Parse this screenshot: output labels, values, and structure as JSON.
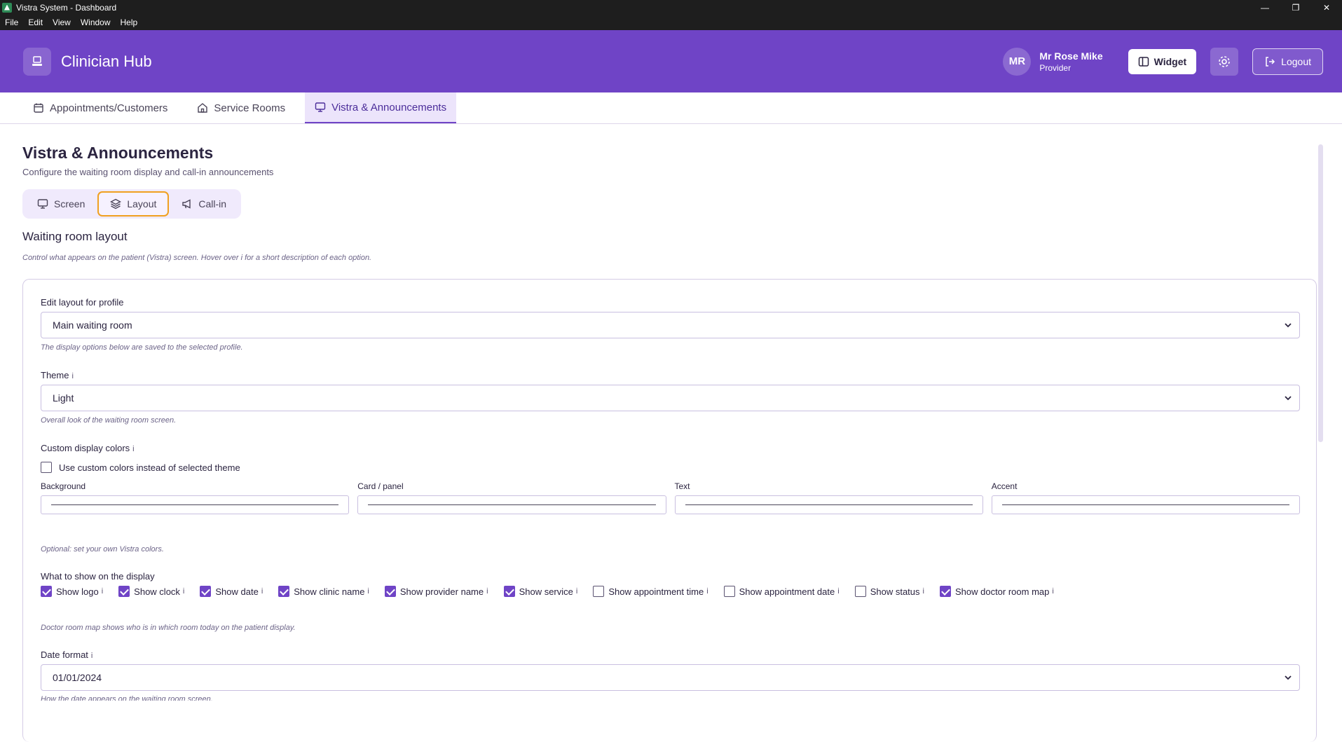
{
  "window": {
    "title": "Vistra System - Dashboard",
    "menu": [
      "File",
      "Edit",
      "View",
      "Window",
      "Help"
    ]
  },
  "header": {
    "brand": "Clinician Hub",
    "user": {
      "initials": "MR",
      "name": "Mr Rose Mike",
      "role": "Provider"
    },
    "widget_label": "Widget",
    "logout_label": "Logout"
  },
  "tabs": [
    {
      "label": "Appointments/Customers",
      "icon": "calendar-icon"
    },
    {
      "label": "Service Rooms",
      "icon": "home-icon"
    },
    {
      "label": "Vistra & Announcements",
      "icon": "monitor-icon",
      "active": true
    }
  ],
  "page": {
    "title": "Vistra & Announcements",
    "subtitle": "Configure the waiting room display and call-in announcements",
    "segments": [
      {
        "label": "Screen",
        "icon": "monitor-icon"
      },
      {
        "label": "Layout",
        "icon": "layers-icon",
        "active": true
      },
      {
        "label": "Call-in",
        "icon": "megaphone-icon"
      }
    ],
    "section_title": "Waiting room layout",
    "section_desc": "Control what appears on the patient (Vistra) screen. Hover over i for a short description of each option."
  },
  "form": {
    "profile": {
      "label": "Edit layout for profile",
      "value": "Main waiting room",
      "hint": "The display options below are saved to the selected profile."
    },
    "theme": {
      "label": "Theme",
      "info": "i",
      "value": "Light",
      "hint": "Overall look of the waiting room screen."
    },
    "custom_colors": {
      "label": "Custom display colors",
      "info": "i",
      "checkbox_label": "Use custom colors instead of selected theme",
      "checked": false,
      "fields": [
        "Background",
        "Card / panel",
        "Text",
        "Accent"
      ],
      "hint": "Optional: set your own Vistra colors."
    },
    "display_options": {
      "label": "What to show on the display",
      "info": "i",
      "options": [
        {
          "label": "Show logo",
          "checked": true
        },
        {
          "label": "Show clock",
          "checked": true
        },
        {
          "label": "Show date",
          "checked": true
        },
        {
          "label": "Show clinic name",
          "checked": true
        },
        {
          "label": "Show provider name",
          "checked": true
        },
        {
          "label": "Show service",
          "checked": true
        },
        {
          "label": "Show appointment time",
          "checked": false
        },
        {
          "label": "Show appointment date",
          "checked": false
        },
        {
          "label": "Show status",
          "checked": false
        },
        {
          "label": "Show doctor room map",
          "checked": true
        }
      ],
      "hint": "Doctor room map shows who is in which room today on the patient display."
    },
    "date_format": {
      "label": "Date format",
      "info": "i",
      "value": "01/01/2024",
      "hint": "How the date appears on the waiting room screen."
    }
  },
  "colors": {
    "brand": "#6f44c6",
    "active_segment_border": "#f0a020",
    "titlebar": "#1e1e1e"
  }
}
